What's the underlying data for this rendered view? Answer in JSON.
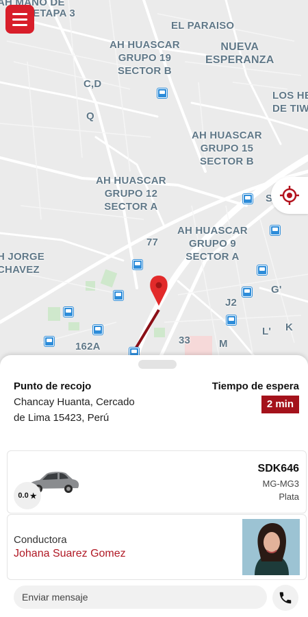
{
  "map": {
    "labels": [
      "AH MANO DE",
      "ETAPA 3",
      "EL PARAISO",
      "AH HUASCAR\nGRUPO 19\nSECTOR B",
      "NUEVA\nESPERANZA",
      "C,D",
      "Q",
      "LOS HE\nDE TIW",
      "AH HUASCAR\nGRUPO 15\nSECTOR B",
      "AH HUASCAR\nGRUPO 12\nSECTOR A",
      "S",
      "77",
      "AH HUASCAR\nGRUPO 9\nSECTOR A",
      "H JORGE\nCHAVEZ",
      "G'",
      "J2",
      "L'",
      "K",
      "162A",
      "33",
      "M"
    ]
  },
  "pickup": {
    "title": "Punto de recojo",
    "address": "Chancay Huanta, Cercado de Lima 15423, Perú"
  },
  "wait": {
    "title": "Tiempo de espera",
    "value": "2 min"
  },
  "vehicle": {
    "rating": "0.0",
    "plate": "SDK646",
    "model": "MG-MG3",
    "color": "Plata"
  },
  "driver": {
    "role": "Conductora",
    "name": "Johana Suarez Gomez"
  },
  "message": {
    "placeholder": "Enviar mensaje"
  },
  "icons": {
    "menu": "menu-icon",
    "locate": "crosshair-icon",
    "pin": "map-pin-icon",
    "star": "star-icon",
    "phone": "phone-icon",
    "bus": "bus-stop-icon"
  },
  "colors": {
    "accent": "#d81e2a",
    "badge": "#a4121b",
    "driver_name": "#b01824",
    "route": "#8b0f16"
  }
}
